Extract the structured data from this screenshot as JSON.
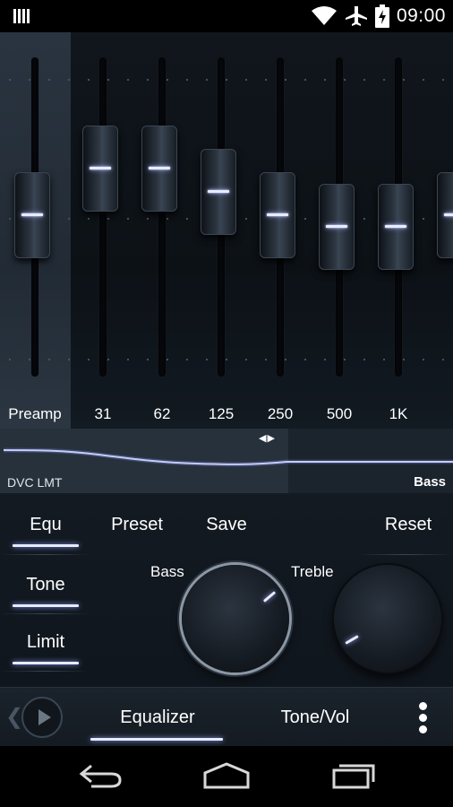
{
  "status_bar": {
    "time": "09:00",
    "icons": [
      "notification-bars-icon",
      "wifi-icon",
      "airplane-mode-icon",
      "battery-charging-icon"
    ]
  },
  "equalizer": {
    "bands": [
      {
        "label": "Preamp",
        "level": 0.5
      },
      {
        "label": "31",
        "level": 0.7
      },
      {
        "label": "62",
        "level": 0.7
      },
      {
        "label": "125",
        "level": 0.6
      },
      {
        "label": "250",
        "level": 0.5
      },
      {
        "label": "500",
        "level": 0.45
      },
      {
        "label": "1K",
        "level": 0.45
      },
      {
        "label": "",
        "level": 0.5
      }
    ]
  },
  "curve_panel": {
    "limiter_label": "DVC LMT",
    "bass_label": "Bass",
    "arrows": "◀▶"
  },
  "controls": {
    "equ_label": "Equ",
    "preset_label": "Preset",
    "save_label": "Save",
    "reset_label": "Reset",
    "tone_label": "Tone",
    "limit_label": "Limit",
    "bass_knob_label": "Bass",
    "treble_knob_label": "Treble"
  },
  "bottom_tabs": {
    "equalizer_label": "Equalizer",
    "tone_vol_label": "Tone/Vol"
  },
  "colors": {
    "accent_glow": "#e6ebff",
    "panel_bg": "#131a22",
    "preamp_bg": "#2a3440"
  }
}
